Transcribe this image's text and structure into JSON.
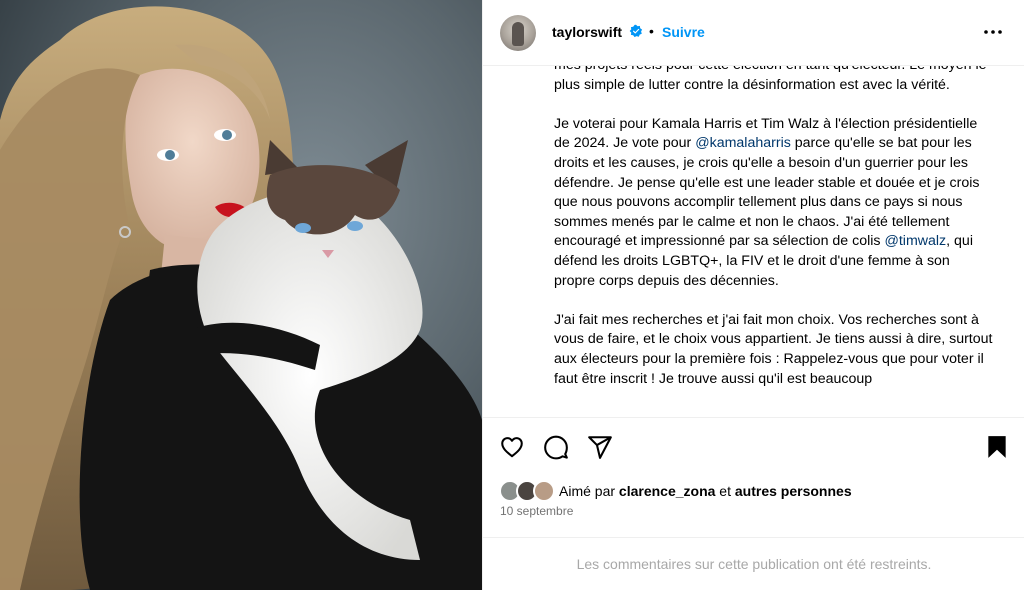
{
  "post": {
    "image_alt": "Woman with long wavy hair holding a fluffy ragdoll cat",
    "username": "taylorswift",
    "verified_icon": "verified-badge-icon",
    "separator": "•",
    "follow_label": "Suivre",
    "more_icon": "more-options-icon"
  },
  "caption": {
    "p1": "mes projets réels pour cette élection en tant qu'électeur. Le moyen le plus simple de lutter contre la désinformation est avec la vérité.",
    "p2_a": "Je voterai pour Kamala Harris et Tim Walz à l'élection présidentielle de 2024. Je vote pour ",
    "mention1": "@kamalaharris",
    "p2_b": " parce qu'elle se bat pour les droits et les causes, je crois qu'elle a besoin d'un guerrier pour les défendre. Je pense qu'elle est une leader stable et douée et je crois que nous pouvons accomplir tellement plus dans ce pays si nous sommes menés par le calme et non le chaos. J'ai été tellement encouragé et impressionné par sa sélection de colis ",
    "mention2": "@timwalz",
    "p2_c": ", qui défend les droits LGBTQ+, la FIV et le droit d'une femme à son propre corps depuis des décennies.",
    "p3": "J'ai fait mes recherches et j'ai fait mon choix. Vos recherches sont à vous de faire, et le choix vous appartient. Je tiens aussi à dire, surtout aux électeurs pour la première fois : Rappelez-vous que pour voter il faut être inscrit ! Je trouve aussi qu'il est beaucoup"
  },
  "actions": {
    "like_icon": "heart-icon",
    "comment_icon": "comment-icon",
    "share_icon": "share-icon",
    "save_icon": "bookmark-icon"
  },
  "likes": {
    "prefix": "Aimé par ",
    "user": "clarence_zona",
    "conjunction": " et ",
    "others": "autres personnes"
  },
  "date": "10 septembre",
  "comments_restricted": "Les commentaires sur cette publication ont été restreints.",
  "colors": {
    "accent": "#0095f6",
    "mention": "#00376b",
    "muted": "#737373"
  }
}
